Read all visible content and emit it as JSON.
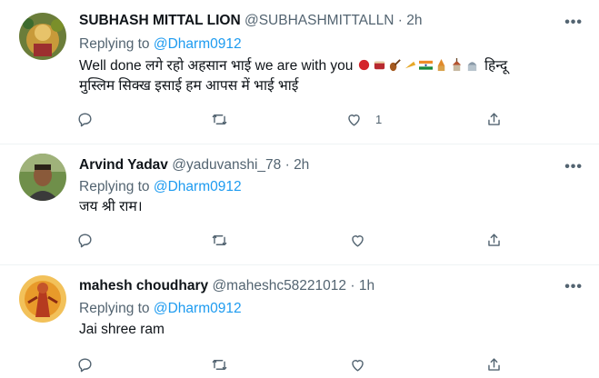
{
  "tweets": [
    {
      "name": "SUBHASH MITTAL LION",
      "handle": "@SUBHASHMITTALLN",
      "separator": "·",
      "time": "2h",
      "replying_prefix": "Replying to ",
      "replying_to": "@Dharm0912",
      "text_line1": "Well done लगे रहो अहसान भाई we are with you",
      "text_line1_tail": "हिन्दू",
      "text_line2": "मुस्लिम सिक्ख इसाई हम आपस में भाई भाई",
      "like_count": "1"
    },
    {
      "name": "Arvind Yadav",
      "handle": "@yaduvanshi_78",
      "separator": "·",
      "time": "2h",
      "replying_prefix": "Replying to ",
      "replying_to": "@Dharm0912",
      "text_line1": "जय श्री राम।"
    },
    {
      "name": "mahesh choudhary",
      "handle": "@maheshc58221012",
      "separator": "·",
      "time": "1h",
      "replying_prefix": "Replying to ",
      "replying_to": "@Dharm0912",
      "text_line1": "Jai shree ram"
    }
  ],
  "more_label": "•••",
  "colors": {
    "link": "#1d9bf0",
    "secondary": "#536471",
    "text": "#0f1419",
    "divider": "#eff3f4"
  },
  "icons": [
    "reply-icon",
    "retweet-icon",
    "like-icon",
    "share-icon",
    "more-icon"
  ]
}
